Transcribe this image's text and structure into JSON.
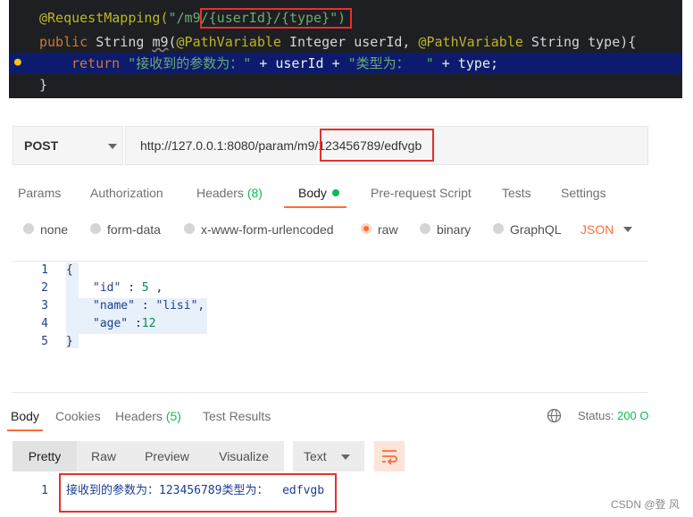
{
  "code": {
    "line1": {
      "ann": "@RequestMapping(",
      "str1": "\"/m9",
      "str_box": "/{userId}/{type}",
      "str2": "\")"
    },
    "line2": {
      "kw": "public",
      "type1": " String ",
      "fn": "m9",
      "p1": "(",
      "ann1": "@PathVariable",
      "t1": " Integer userId, ",
      "ann2": "@PathVariable",
      "t2": " String type){"
    },
    "line3": {
      "kw": "return",
      "s1": " \"接收到的参数为：\"",
      "op1": " + userId + ",
      "s2": "\"类型为：  \"",
      "op2": " + type;"
    },
    "line4": {
      "brace": "}"
    }
  },
  "request": {
    "method": "POST",
    "url_prefix": "http://127.0.0.1:8080/param/m9/",
    "url_highlight": "123456789/edfvgb"
  },
  "tabs": [
    {
      "label": "Params"
    },
    {
      "label": "Authorization"
    },
    {
      "label": "Headers",
      "count": "(8)"
    },
    {
      "label": "Body",
      "active": true
    },
    {
      "label": "Pre-request Script"
    },
    {
      "label": "Tests"
    },
    {
      "label": "Settings"
    }
  ],
  "body_modes": [
    {
      "label": "none"
    },
    {
      "label": "form-data"
    },
    {
      "label": "x-www-form-urlencoded"
    },
    {
      "label": "raw",
      "selected": true
    },
    {
      "label": "binary"
    },
    {
      "label": "GraphQL"
    }
  ],
  "format": {
    "label": "JSON",
    "color": "#ff6c37"
  },
  "json_lines": [
    {
      "num": "1",
      "text": "{"
    },
    {
      "num": "2",
      "key": "\"id\"",
      "sep": " : ",
      "val": "5",
      "tail": " ,"
    },
    {
      "num": "3",
      "key": "\"name\"",
      "sep": " : ",
      "val": "\"lisi\"",
      "tail": ","
    },
    {
      "num": "4",
      "key": "\"age\"",
      "sep": " :",
      "val": "12",
      "tail": ""
    },
    {
      "num": "5",
      "text": "}"
    }
  ],
  "response_tabs": [
    {
      "label": "Body",
      "active": true
    },
    {
      "label": "Cookies"
    },
    {
      "label": "Headers",
      "count": "(5)"
    },
    {
      "label": "Test Results"
    }
  ],
  "status": {
    "label": "Status:",
    "value": "200 O"
  },
  "view_buttons": [
    "Pretty",
    "Raw",
    "Preview",
    "Visualize"
  ],
  "response_format": "Text",
  "response": {
    "line_num": "1",
    "text": "接收到的参数为：123456789类型为：  edfvgb"
  },
  "watermark": "CSDN @登 风",
  "colors": {
    "accent": "#ff6c37",
    "green": "#0cbb52",
    "highlight_box": "#e53030"
  }
}
